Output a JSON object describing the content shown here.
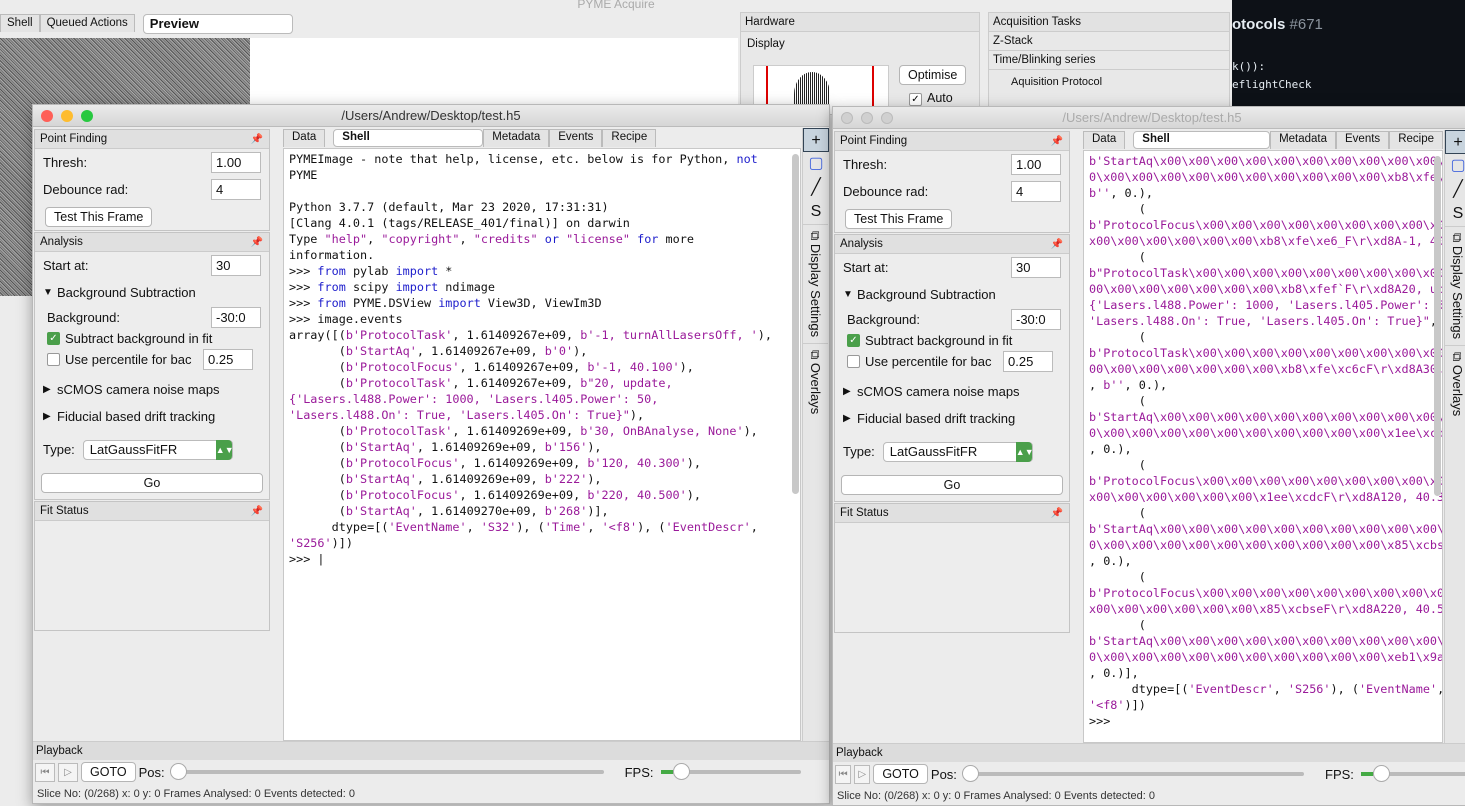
{
  "acquire": {
    "title": "PYME Acquire",
    "tabs": [
      "Shell",
      "Queued Actions",
      "Preview"
    ],
    "hardware": "Hardware",
    "display": "Display",
    "optimise": "Optimise",
    "auto": "Auto",
    "acq_tasks": "Acquisition Tasks",
    "zstack": "Z-Stack",
    "time_series": "Time/Blinking series",
    "acq_protocol": "Aquisition Protocol"
  },
  "background_editor": {
    "title": "otocols",
    "issue": "#671",
    "line1": "k()):",
    "line2": "eflightCheck"
  },
  "windows": [
    {
      "title": "/Users/Andrew/Desktop/test.h5",
      "active": true,
      "point_finding": {
        "title": "Point Finding",
        "thresh_label": "Thresh:",
        "thresh": "1.00",
        "debounce_label": "Debounce rad:",
        "debounce": "4",
        "test_button": "Test This Frame"
      },
      "analysis": {
        "title": "Analysis",
        "start_label": "Start at:",
        "start": "30",
        "bg_sub": "Background Subtraction",
        "bg_label": "Background:",
        "bg": "-30:0",
        "subtract": "Subtract background in fit",
        "subtract_checked": true,
        "percentile": "Use percentile for bac",
        "percentile_val": "0.25",
        "percentile_checked": false,
        "scmos": "sCMOS camera noise maps",
        "fiducial": "Fiducial based drift tracking",
        "type_label": "Type:",
        "type": "LatGaussFitFR",
        "go": "Go"
      },
      "fit_status": "Fit Status",
      "tabs": [
        "Data",
        "Shell",
        "Metadata",
        "Events",
        "Recipe"
      ],
      "toolbar": {
        "display_settings": "Display Settings",
        "overlays": "Overlays"
      },
      "playback": {
        "title": "Playback",
        "goto": "GOTO",
        "pos": "Pos:",
        "fps": "FPS:"
      },
      "status": "Slice No: (0/268)   x: 0   y: 0   Frames Analysed: 0   Events detected: 0",
      "shell": [
        [
          [
            "PYMEImage - note that help, license, etc. below ",
            ""
          ],
          [
            "is for",
            ""
          ],
          [
            " Python, ",
            ""
          ],
          [
            "not",
            "k"
          ]
        ],
        [
          [
            "PYME",
            ""
          ]
        ],
        [
          [
            "",
            ""
          ]
        ],
        [
          [
            "Python 3.7.7 (default, Mar 23 2020, 17:31:31)",
            ""
          ]
        ],
        [
          [
            "[Clang 4.0.1 (tags/RELEASE_401/final)] on darwin",
            ""
          ]
        ],
        [
          [
            "Type ",
            ""
          ],
          [
            "\"help\"",
            "s"
          ],
          [
            ", ",
            ""
          ],
          [
            "\"copyright\"",
            "s"
          ],
          [
            ", ",
            ""
          ],
          [
            "\"credits\"",
            "s"
          ],
          [
            " or ",
            "k"
          ],
          [
            "\"license\"",
            "s"
          ],
          [
            " for",
            "k"
          ],
          [
            " more",
            ""
          ]
        ],
        [
          [
            "information.",
            ""
          ]
        ],
        [
          [
            ">>> ",
            ""
          ],
          [
            "from",
            "k"
          ],
          [
            " pylab ",
            ""
          ],
          [
            "import",
            "k"
          ],
          [
            " *",
            ""
          ]
        ],
        [
          [
            ">>> ",
            ""
          ],
          [
            "from",
            "k"
          ],
          [
            " scipy ",
            ""
          ],
          [
            "import",
            "k"
          ],
          [
            " ndimage",
            ""
          ]
        ],
        [
          [
            ">>> ",
            ""
          ],
          [
            "from",
            "k"
          ],
          [
            " PYME.DSView ",
            ""
          ],
          [
            "import",
            "k"
          ],
          [
            " View3D, ViewIm3D",
            ""
          ]
        ],
        [
          [
            ">>> image.events",
            ""
          ]
        ],
        [
          [
            "array([(",
            ""
          ],
          [
            "b'ProtocolTask'",
            "s"
          ],
          [
            ", 1.61409267e+09, ",
            ""
          ],
          [
            "b'-1, turnAllLasersOff, '",
            "s"
          ],
          [
            "),",
            ""
          ]
        ],
        [
          [
            "       (",
            ""
          ],
          [
            "b'StartAq'",
            "s"
          ],
          [
            ", 1.61409267e+09, ",
            ""
          ],
          [
            "b'0'",
            "s"
          ],
          [
            "),",
            ""
          ]
        ],
        [
          [
            "       (",
            ""
          ],
          [
            "b'ProtocolFocus'",
            "s"
          ],
          [
            ", 1.61409267e+09, ",
            ""
          ],
          [
            "b'-1, 40.100'",
            "s"
          ],
          [
            "),",
            ""
          ]
        ],
        [
          [
            "       (",
            ""
          ],
          [
            "b'ProtocolTask'",
            "s"
          ],
          [
            ", 1.61409267e+09, ",
            ""
          ],
          [
            "b\"20, update,",
            "s"
          ]
        ],
        [
          [
            "{'Lasers.l488.Power': 1000, 'Lasers.l405.Power': 50,",
            "s"
          ]
        ],
        [
          [
            "'Lasers.l488.On': True, 'Lasers.l405.On': True}\"",
            "s"
          ],
          [
            "),",
            ""
          ]
        ],
        [
          [
            "       (",
            ""
          ],
          [
            "b'ProtocolTask'",
            "s"
          ],
          [
            ", 1.61409269e+09, ",
            ""
          ],
          [
            "b'30, OnBAnalyse, None'",
            "s"
          ],
          [
            "),",
            ""
          ]
        ],
        [
          [
            "       (",
            ""
          ],
          [
            "b'StartAq'",
            "s"
          ],
          [
            ", 1.61409269e+09, ",
            ""
          ],
          [
            "b'156'",
            "s"
          ],
          [
            "),",
            ""
          ]
        ],
        [
          [
            "       (",
            ""
          ],
          [
            "b'ProtocolFocus'",
            "s"
          ],
          [
            ", 1.61409269e+09, ",
            ""
          ],
          [
            "b'120, 40.300'",
            "s"
          ],
          [
            "),",
            ""
          ]
        ],
        [
          [
            "       (",
            ""
          ],
          [
            "b'StartAq'",
            "s"
          ],
          [
            ", 1.61409269e+09, ",
            ""
          ],
          [
            "b'222'",
            "s"
          ],
          [
            "),",
            ""
          ]
        ],
        [
          [
            "       (",
            ""
          ],
          [
            "b'ProtocolFocus'",
            "s"
          ],
          [
            ", 1.61409269e+09, ",
            ""
          ],
          [
            "b'220, 40.500'",
            "s"
          ],
          [
            "),",
            ""
          ]
        ],
        [
          [
            "       (",
            ""
          ],
          [
            "b'StartAq'",
            "s"
          ],
          [
            ", 1.61409270e+09, ",
            ""
          ],
          [
            "b'268'",
            "s"
          ],
          [
            ")],",
            ""
          ]
        ],
        [
          [
            "      dtype=[(",
            ""
          ],
          [
            "'EventName'",
            "s"
          ],
          [
            ", ",
            ""
          ],
          [
            "'S32'",
            "s"
          ],
          [
            "), (",
            ""
          ],
          [
            "'Time'",
            "s"
          ],
          [
            ", ",
            ""
          ],
          [
            "'<f8'",
            "s"
          ],
          [
            "), (",
            ""
          ],
          [
            "'EventDescr'",
            "s"
          ],
          [
            ",",
            ""
          ]
        ],
        [
          [
            "'S256'",
            "s"
          ],
          [
            ")])",
            ""
          ]
        ],
        [
          [
            ">>> |",
            ""
          ]
        ]
      ]
    },
    {
      "title": "/Users/Andrew/Desktop/test.h5",
      "active": false,
      "point_finding": {
        "title": "Point Finding",
        "thresh_label": "Thresh:",
        "thresh": "1.00",
        "debounce_label": "Debounce rad:",
        "debounce": "4",
        "test_button": "Test This Frame"
      },
      "analysis": {
        "title": "Analysis",
        "start_label": "Start at:",
        "start": "30",
        "bg_sub": "Background Subtraction",
        "bg_label": "Background:",
        "bg": "-30:0",
        "subtract": "Subtract background in fit",
        "subtract_checked": true,
        "percentile": "Use percentile for bac",
        "percentile_val": "0.25",
        "percentile_checked": false,
        "scmos": "sCMOS camera noise maps",
        "fiducial": "Fiducial based drift tracking",
        "type_label": "Type:",
        "type": "LatGaussFitFR",
        "go": "Go"
      },
      "fit_status": "Fit Status",
      "tabs": [
        "Data",
        "Shell",
        "Metadata",
        "Events",
        "Recipe"
      ],
      "toolbar": {
        "display_settings": "Display Settings",
        "overlays": "Overlays"
      },
      "playback": {
        "title": "Playback",
        "goto": "GOTO",
        "pos": "Pos:",
        "fps": "FPS:"
      },
      "status": "Slice No: (0/268)   x: 0   y: 0   Frames Analysed: 0   Events detected: 0",
      "shell": [
        [
          [
            "b'StartAq\\x00\\x00\\x00\\x00\\x00\\x00\\x00\\x00\\x00\\x00\\x0",
            "s"
          ]
        ],
        [
          [
            "0\\x00\\x00\\x00\\x00\\x00\\x00\\x00\\x00\\x00\\x00\\xb8\\xfe\\xe",
            "s"
          ]
        ],
        [
          [
            "b''",
            "s"
          ],
          [
            ", 0.),",
            ""
          ]
        ],
        [
          [
            "       (",
            ""
          ]
        ],
        [
          [
            "b'ProtocolFocus\\x00\\x00\\x00\\x00\\x00\\x00\\x00\\x00\\x00\\",
            "s"
          ]
        ],
        [
          [
            "x00\\x00\\x00\\x00\\x00\\x00\\xb8\\xfe\\xe6_F\\r\\xd8A-1, 40.1",
            "s"
          ]
        ],
        [
          [
            "       (",
            ""
          ]
        ],
        [
          [
            "b\"ProtocolTask\\x00\\x00\\x00\\x00\\x00\\x00\\x00\\x00\\x00\\x",
            "s"
          ]
        ],
        [
          [
            "00\\x00\\x00\\x00\\x00\\x00\\x00\\xb8\\xfef`F\\r\\xd8A20, upda",
            "s"
          ]
        ],
        [
          [
            "{'Lasers.l488.Power': 1000, 'Lasers.l405.Power': 50,",
            "s"
          ]
        ],
        [
          [
            "'Lasers.l488.On': True, 'Lasers.l405.On': True}\"",
            "s"
          ],
          [
            ", ",
            ""
          ],
          [
            "b'",
            "s"
          ]
        ],
        [
          [
            "       (",
            ""
          ]
        ],
        [
          [
            "b'ProtocolTask\\x00\\x00\\x00\\x00\\x00\\x00\\x00\\x00\\x00\\x",
            "s"
          ]
        ],
        [
          [
            "00\\x00\\x00\\x00\\x00\\x00\\x00\\xb8\\xfe\\xc6cF\\r\\xd8A30, O",
            "s"
          ]
        ],
        [
          [
            ", ",
            ""
          ],
          [
            "b''",
            "s"
          ],
          [
            ", 0.),",
            ""
          ]
        ],
        [
          [
            "       (",
            ""
          ]
        ],
        [
          [
            "b'StartAq\\x00\\x00\\x00\\x00\\x00\\x00\\x00\\x00\\x00\\x00\\x0",
            "s"
          ]
        ],
        [
          [
            "0\\x00\\x00\\x00\\x00\\x00\\x00\\x00\\x00\\x00\\x00\\x1ee\\xcdcF",
            "s"
          ]
        ],
        [
          [
            ", 0.),",
            ""
          ]
        ],
        [
          [
            "       (",
            ""
          ]
        ],
        [
          [
            "b'ProtocolFocus\\x00\\x00\\x00\\x00\\x00\\x00\\x00\\x00\\x00\\",
            "s"
          ]
        ],
        [
          [
            "x00\\x00\\x00\\x00\\x00\\x00\\x1ee\\xcdcF\\r\\xd8A120, 40.300",
            "s"
          ]
        ],
        [
          [
            "       (",
            ""
          ]
        ],
        [
          [
            "b'StartAq\\x00\\x00\\x00\\x00\\x00\\x00\\x00\\x00\\x00\\x00\\x0",
            "s"
          ]
        ],
        [
          [
            "0\\x00\\x00\\x00\\x00\\x00\\x00\\x00\\x00\\x00\\x00\\x85\\xcbseF",
            "s"
          ]
        ],
        [
          [
            ", 0.),",
            ""
          ]
        ],
        [
          [
            "       (",
            ""
          ]
        ],
        [
          [
            "b'ProtocolFocus\\x00\\x00\\x00\\x00\\x00\\x00\\x00\\x00\\x00\\",
            "s"
          ]
        ],
        [
          [
            "x00\\x00\\x00\\x00\\x00\\x00\\x85\\xcbseF\\r\\xd8A220, 40.500",
            "s"
          ]
        ],
        [
          [
            "       (",
            ""
          ]
        ],
        [
          [
            "b'StartAq\\x00\\x00\\x00\\x00\\x00\\x00\\x00\\x00\\x00\\x00\\x0",
            "s"
          ]
        ],
        [
          [
            "0\\x00\\x00\\x00\\x00\\x00\\x00\\x00\\x00\\x00\\x00\\xeb1\\x9afF",
            "s"
          ]
        ],
        [
          [
            ", 0.)],",
            ""
          ]
        ],
        [
          [
            "      dtype=[(",
            ""
          ],
          [
            "'EventDescr'",
            "s"
          ],
          [
            ", ",
            ""
          ],
          [
            "'S256'",
            "s"
          ],
          [
            "), (",
            ""
          ],
          [
            "'EventName'",
            "s"
          ],
          [
            ", ",
            ""
          ],
          [
            "'S",
            "s"
          ]
        ],
        [
          [
            "'<f8'",
            "s"
          ],
          [
            ")])",
            ""
          ]
        ],
        [
          [
            ">>>",
            ""
          ]
        ]
      ]
    }
  ]
}
